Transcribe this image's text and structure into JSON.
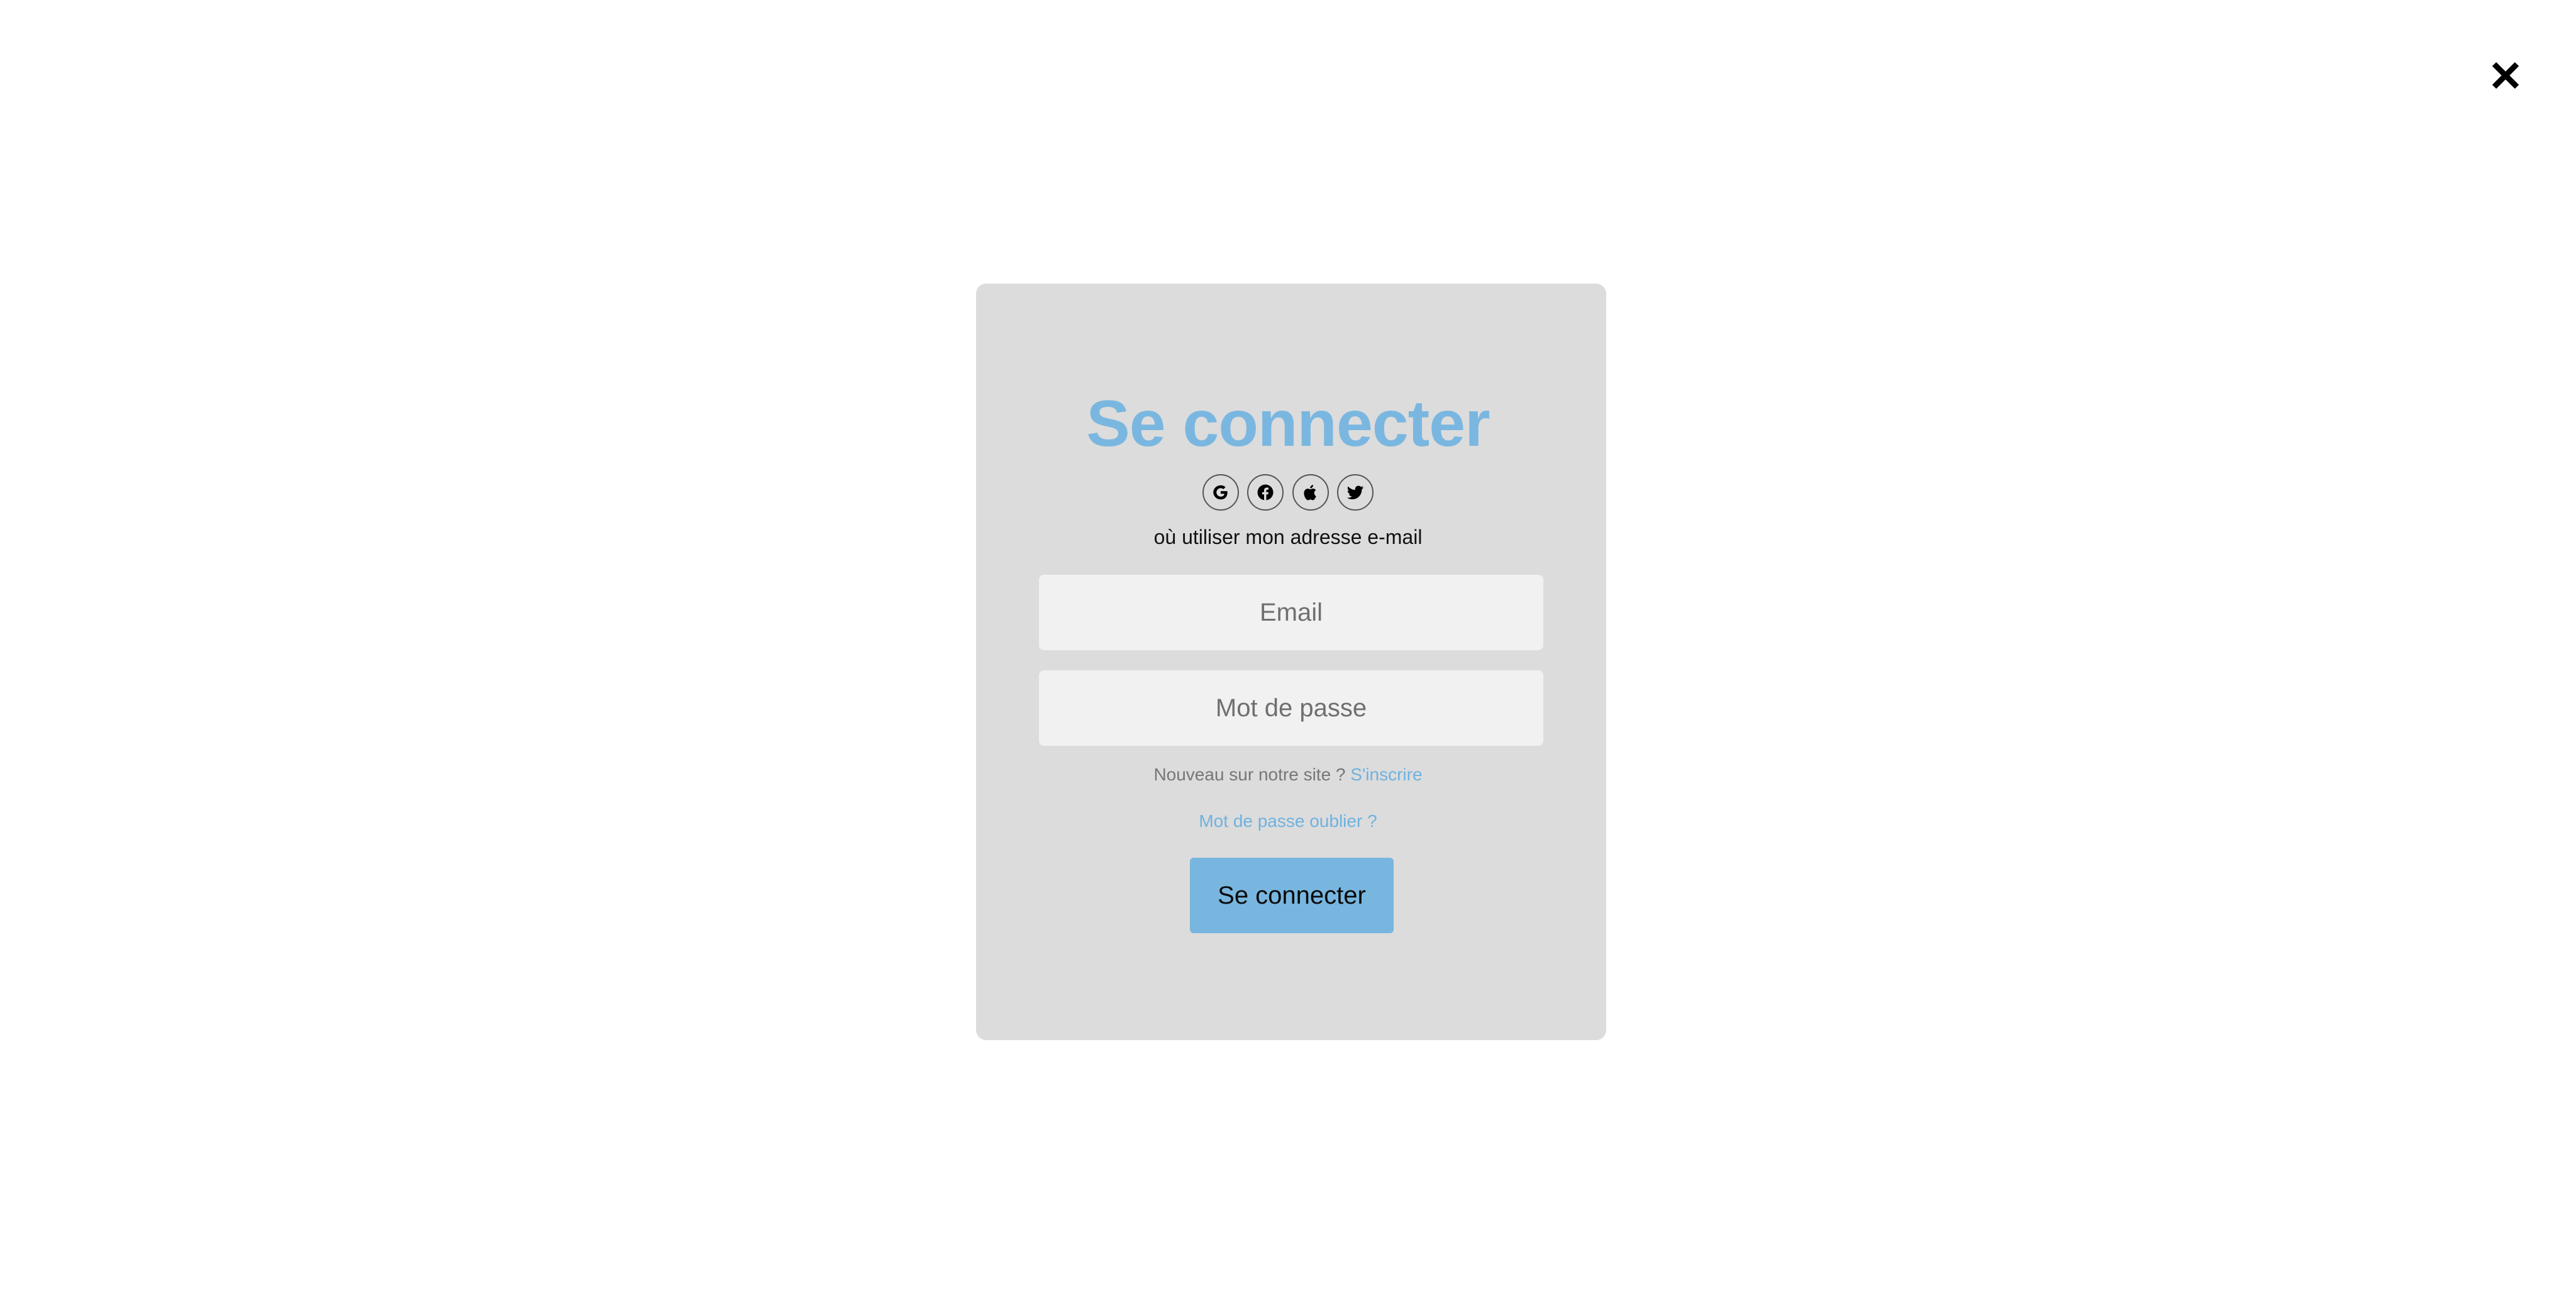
{
  "modal": {
    "close_icon": "close-icon"
  },
  "login": {
    "title": "Se connecter",
    "social": [
      {
        "icon": "google-icon"
      },
      {
        "icon": "facebook-icon"
      },
      {
        "icon": "apple-icon"
      },
      {
        "icon": "twitter-icon"
      }
    ],
    "email_hint": "où utiliser mon adresse e-mail",
    "email_placeholder": "Email",
    "email_value": "",
    "password_placeholder": "Mot de passe",
    "password_value": "",
    "signup_prompt": "Nouveau sur notre site ?",
    "signup_link": "S'inscrire",
    "forgot_link": "Mot de passe oublier ?",
    "submit_label": "Se connecter"
  },
  "colors": {
    "accent": "#7ab7e0",
    "card_bg": "#dcdcdc",
    "field_bg": "#f1f1f1",
    "button_bg": "#78b6df"
  }
}
